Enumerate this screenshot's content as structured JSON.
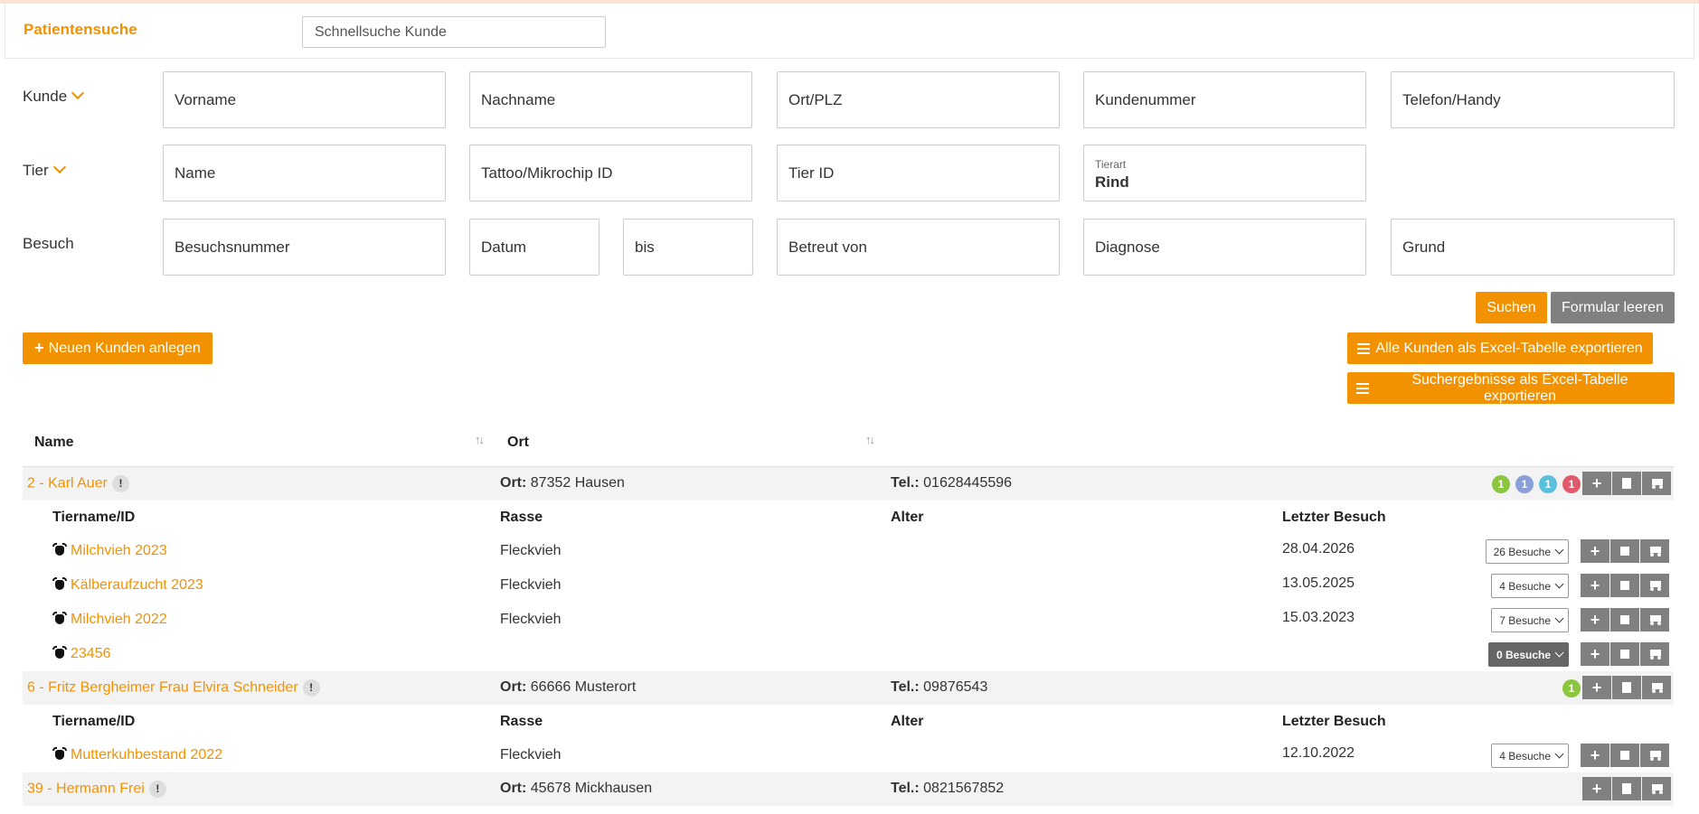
{
  "header": {
    "title": "Patientensuche",
    "quick_search_placeholder": "Schnellsuche Kunde"
  },
  "search_form": {
    "kunde": {
      "label": "Kunde",
      "vorname": "Vorname",
      "nachname": "Nachname",
      "ort_plz": "Ort/PLZ",
      "kundennummer": "Kundenummer",
      "telefon": "Telefon/Handy"
    },
    "tier": {
      "label": "Tier",
      "name": "Name",
      "tattoo": "Tattoo/Mikrochip ID",
      "tier_id": "Tier ID",
      "tierart_label": "Tierart",
      "tierart_value": "Rind"
    },
    "besuch": {
      "label": "Besuch",
      "besuchsnummer": "Besuchsnummer",
      "datum": "Datum",
      "bis": "bis",
      "betreut_von": "Betreut von",
      "diagnose": "Diagnose",
      "grund": "Grund"
    },
    "search_button": "Suchen",
    "clear_button": "Formular leeren"
  },
  "actions": {
    "new_customer": "Neuen Kunden anlegen",
    "export_all": "Alle Kunden als Excel-Tabelle exportieren",
    "export_results": "Suchergebnisse als Excel-Tabelle exportieren"
  },
  "table": {
    "col_name": "Name",
    "col_ort": "Ort",
    "sub_tiername": "Tiername/ID",
    "sub_rasse": "Rasse",
    "sub_alter": "Alter",
    "sub_letzter": "Letzter Besuch",
    "ort_prefix": "Ort:",
    "tel_prefix": "Tel.:",
    "info_badge": "!",
    "customers": [
      {
        "name": "2 - Karl Auer",
        "ort": "87352 Hausen",
        "tel": "01628445596",
        "badges": [
          {
            "value": "1",
            "color": "#8cc63f"
          },
          {
            "value": "1",
            "color": "#8a9ed8"
          },
          {
            "value": "1",
            "color": "#5bc0de"
          },
          {
            "value": "1",
            "color": "#e05a6b"
          }
        ],
        "animals": [
          {
            "name": "Milchvieh 2023",
            "rasse": "Fleckvieh",
            "alter": "",
            "letzter": "28.04.2026",
            "visits": "26 Besuche"
          },
          {
            "name": "Kälberaufzucht 2023",
            "rasse": "Fleckvieh",
            "alter": "",
            "letzter": "13.05.2025",
            "visits": "4 Besuche"
          },
          {
            "name": "Milchvieh 2022",
            "rasse": "Fleckvieh",
            "alter": "",
            "letzter": "15.03.2023",
            "visits": "7 Besuche"
          },
          {
            "name": "23456",
            "rasse": "",
            "alter": "",
            "letzter": "",
            "visits": "0 Besuche"
          }
        ]
      },
      {
        "name": "6 - Fritz Bergheimer Frau Elvira Schneider",
        "ort": "66666 Musterort",
        "tel": "09876543",
        "badges": [
          {
            "value": "1",
            "color": "#8cc63f"
          }
        ],
        "animals": [
          {
            "name": "Mutterkuhbestand 2022",
            "rasse": "Fleckvieh",
            "alter": "",
            "letzter": "12.10.2022",
            "visits": "4 Besuche"
          }
        ]
      },
      {
        "name": "39 - Hermann Frei",
        "ort": "45678 Mickhausen",
        "tel": "0821567852",
        "badges": [],
        "animals": []
      }
    ]
  }
}
